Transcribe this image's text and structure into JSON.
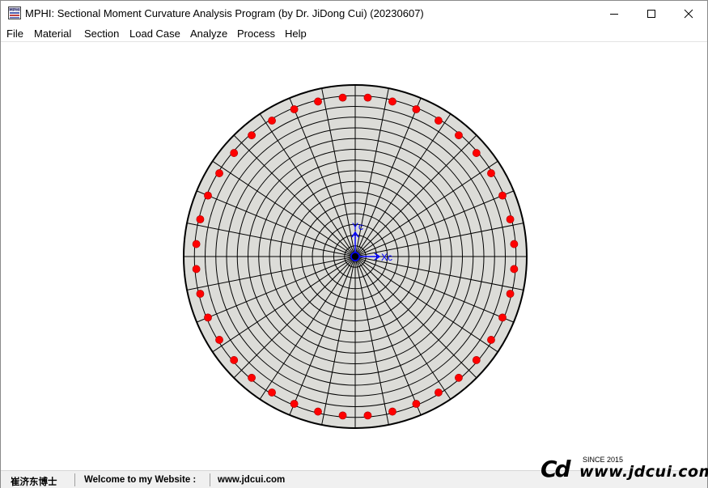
{
  "window": {
    "title": "MPHI: Sectional Moment Curvature Analysis Program (by Dr. JiDong Cui) (20230607)"
  },
  "menu": {
    "items": [
      "File",
      "Material",
      "Section",
      "Load Case",
      "Analyze",
      "Process",
      "Help"
    ]
  },
  "section_view": {
    "shape": "circular",
    "fill_color": "#dcdcd8",
    "grid_color": "#000000",
    "rebar_color": "#ff0000",
    "rebar_count": 40,
    "radial_rings": 16,
    "radial_spokes": 32,
    "axes": {
      "x_label": "Xc",
      "y_label": "Yc",
      "color": "#0000ff"
    }
  },
  "status": {
    "author": "崔济东博士",
    "welcome": "Welcome to my Website :",
    "website": "www.jdcui.com"
  },
  "logo": {
    "mark": "Cd",
    "since": "SINCE 2015",
    "url": "www.jdcui.com"
  }
}
